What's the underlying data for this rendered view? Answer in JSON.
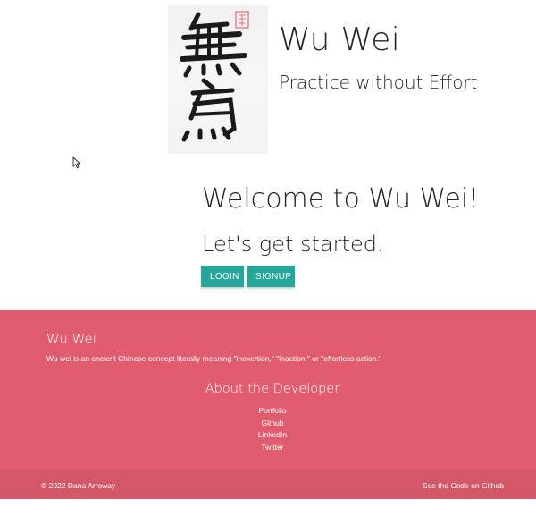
{
  "header": {
    "title": "Wu Wei",
    "tagline": "Practice without Effort",
    "logo_icon": "calligraphy-wu-wei-logo"
  },
  "welcome": {
    "heading": "Welcome to Wu Wei!",
    "subheading": "Let's get started.",
    "login_label": "LOGIN",
    "signup_label": "SIGNUP"
  },
  "footer": {
    "title": "Wu Wei",
    "description": "Wu wei is an ancient Chinese concept literally meaning \"inexertion,\" \"inaction,\" or \"effortless action.\"",
    "developer_heading": "About the Developer",
    "links": [
      "Portfolio",
      "Github",
      "LinkedIn",
      "Twitter"
    ],
    "copyright": "© 2022 Dana Arroway",
    "code_link": "See the Code on Github"
  },
  "colors": {
    "accent": "#26a69a",
    "footer_bg": "#e05d6f",
    "footer_bottom_bg": "#d45768"
  }
}
